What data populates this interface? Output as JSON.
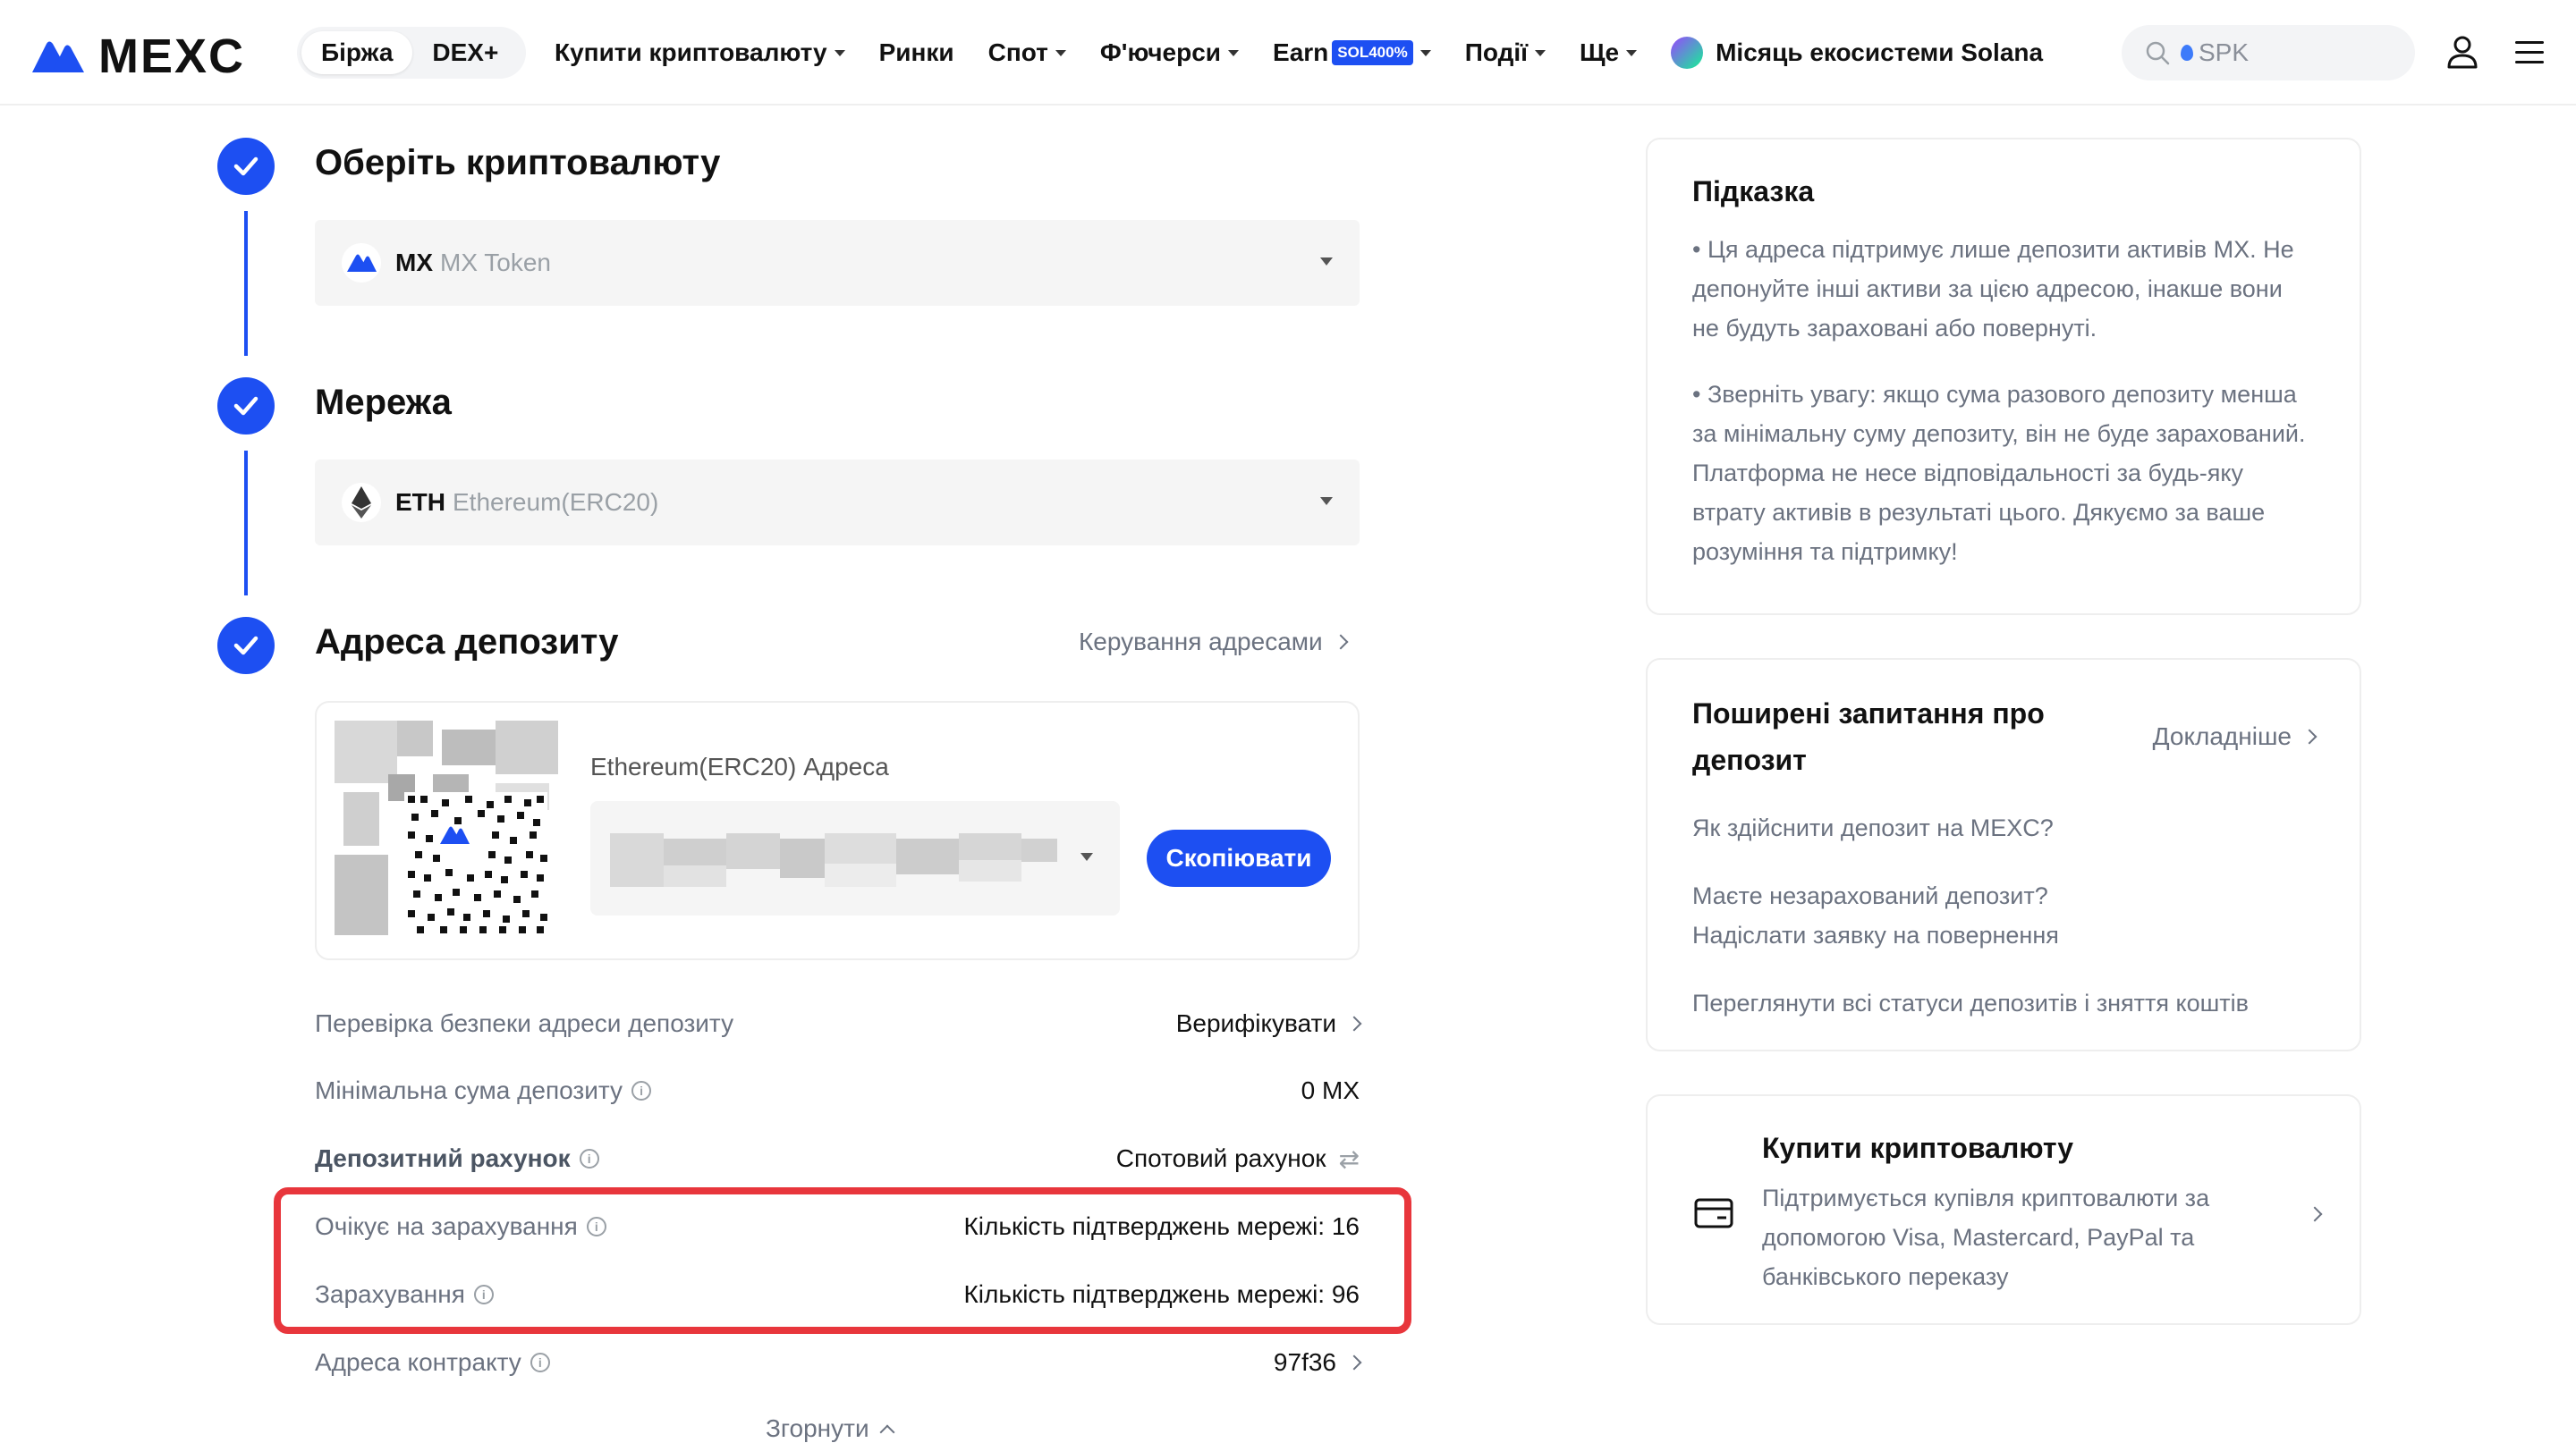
{
  "nav": {
    "logo": "MEXC",
    "segments": [
      "Біржа",
      "DEX+"
    ],
    "items": [
      {
        "label": "Купити криптовалюту",
        "dropdown": true
      },
      {
        "label": "Ринки",
        "dropdown": false
      },
      {
        "label": "Спот",
        "dropdown": true
      },
      {
        "label": "Ф'ючерси",
        "dropdown": true
      },
      {
        "label": "Earn",
        "badge": "SOL400%",
        "dropdown": true
      },
      {
        "label": "Події",
        "dropdown": true
      },
      {
        "label": "Ще",
        "dropdown": true
      }
    ],
    "promo": "Місяць екосистеми Solana",
    "search_value": "SPK"
  },
  "steps": {
    "crypto": {
      "title": "Оберіть криптовалюту",
      "symbol": "MX",
      "name": "MX Token"
    },
    "network": {
      "title": "Мережа",
      "symbol": "ETH",
      "name": "Ethereum(ERC20)"
    },
    "address": {
      "title": "Адреса депозиту",
      "manage_link": "Керування адресами",
      "address_label": "Ethereum(ERC20) Адреса",
      "copy_button": "Скопіювати"
    }
  },
  "details": [
    {
      "label": "Перевірка безпеки адреси депозиту",
      "value": "Верифікувати"
    },
    {
      "label": "Мінімальна сума депозиту",
      "value": "0 MX"
    },
    {
      "label": "Депозитний рахунок",
      "value": "Спотовий рахунок"
    },
    {
      "label": "Очікує на зарахування",
      "value": "Кількість підтверджень мережі: 16"
    },
    {
      "label": "Зарахування",
      "value": "Кількість підтверджень мережі: 96"
    },
    {
      "label": "Адреса контракту",
      "value": "97f36"
    }
  ],
  "collapse_label": "Згорнути",
  "hint": {
    "title": "Підказка",
    "paragraphs": [
      "• Ця адреса підтримує лише депозити активів MX. Не депонуйте інші активи за цією адресою, інакше вони не будуть зараховані або повернуті.",
      "• Зверніть увагу: якщо сума разового депозиту менша за мінімальну суму депозиту, він не буде зарахований. Платформа не несе відповідальності за будь-яку втрату активів в результаті цього. Дякуємо за ваше розуміння та підтримку!"
    ]
  },
  "faq": {
    "title": "Поширені запитання про депозит",
    "more": "Докладніше",
    "links": [
      "Як здійснити депозит на MEXC?",
      "Маєте незарахований депозит? Надіслати заявку на повернення",
      "Переглянути всі статуси депозитів і зняття коштів"
    ]
  },
  "buy": {
    "title": "Купити криптовалюту",
    "text": "Підтримується купівля криптовалюти за допомогою Visa, Mastercard, PayPal та банківського переказу"
  },
  "colors": {
    "accent": "#1d4ff2",
    "highlight": "#e8363c"
  }
}
